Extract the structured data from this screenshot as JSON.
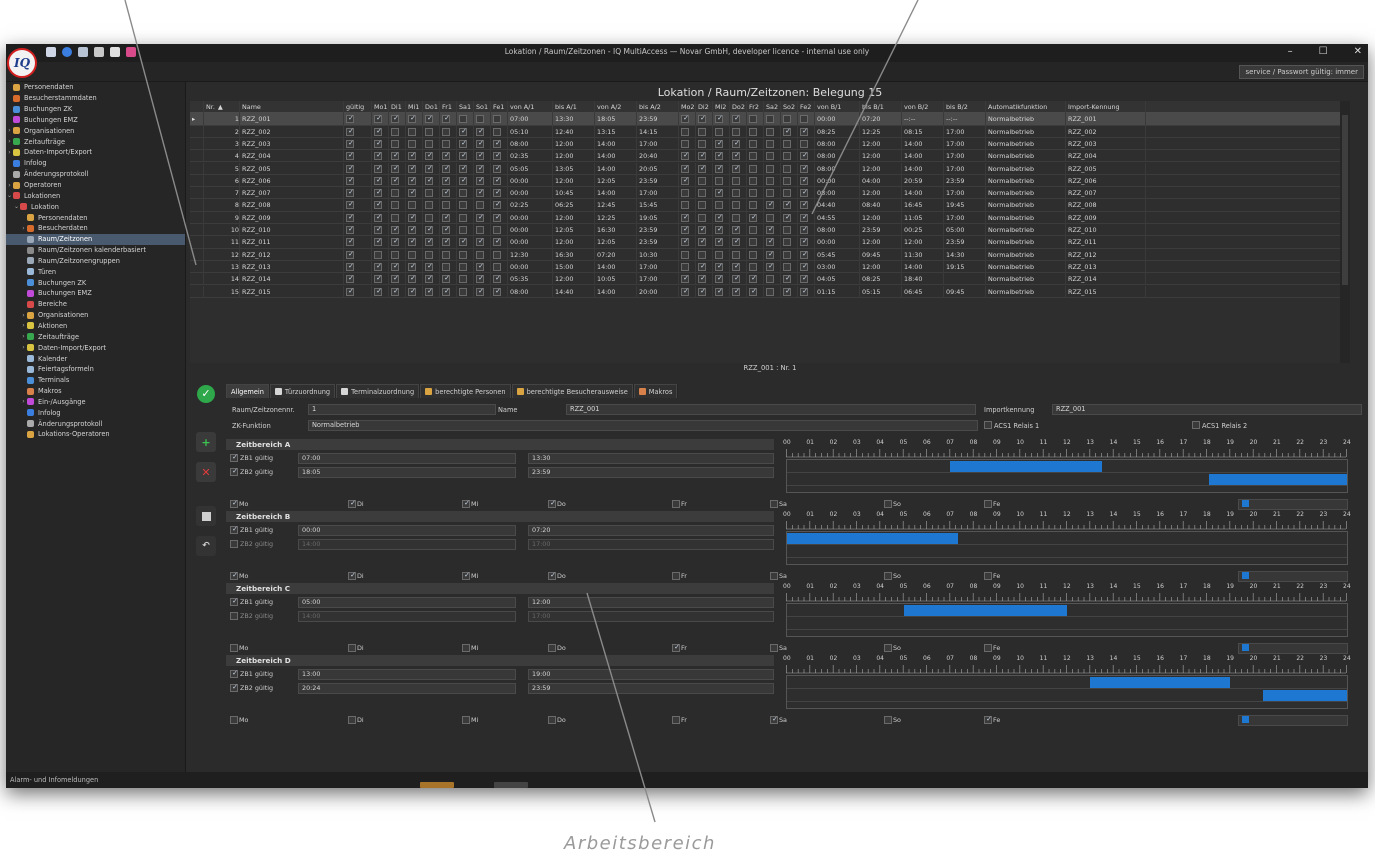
{
  "caption": "Arbeitsbereich",
  "window": {
    "title": "Lokation / Raum/Zeitzonen - IQ MultiAccess — Novar GmbH, developer licence - internal use only",
    "logo_text": "IQ",
    "btn_min": "–",
    "btn_max": "☐",
    "btn_close": "✕",
    "service_button": "service / Passwort gültig: immer",
    "status_text": "Alarm- und Infomeldungen"
  },
  "sidebar": {
    "items": [
      {
        "label": "Personendaten",
        "indent": 0,
        "arrow": "",
        "icon": "#d9a441"
      },
      {
        "label": "Besucherstammdaten",
        "indent": 0,
        "arrow": "",
        "icon": "#d86c2d"
      },
      {
        "label": "Buchungen ZK",
        "indent": 0,
        "arrow": "",
        "icon": "#4a8fd8"
      },
      {
        "label": "Buchungen EMZ",
        "indent": 0,
        "arrow": "",
        "icon": "#c24ad8"
      },
      {
        "label": "Organisationen",
        "indent": 0,
        "arrow": "›",
        "icon": "#d9a441"
      },
      {
        "label": "Zeitaufträge",
        "indent": 0,
        "arrow": "›",
        "icon": "#38a84f"
      },
      {
        "label": "Daten-Import/Export",
        "indent": 0,
        "arrow": "›",
        "icon": "#d9c441"
      },
      {
        "label": "Infolog",
        "indent": 0,
        "arrow": "",
        "icon": "#3a7ee0"
      },
      {
        "label": "Änderungsprotokoll",
        "indent": 0,
        "arrow": "",
        "icon": "#aaaaaa"
      },
      {
        "label": "Operatoren",
        "indent": 0,
        "arrow": "›",
        "icon": "#d9a441"
      },
      {
        "label": "Lokationen",
        "indent": 0,
        "arrow": "⌄",
        "icon": "#d84a4a"
      },
      {
        "label": "Lokation",
        "indent": 1,
        "arrow": "⌄",
        "icon": "#d84a4a"
      },
      {
        "label": "Personendaten",
        "indent": 2,
        "arrow": "",
        "icon": "#d9a441"
      },
      {
        "label": "Besucherdaten",
        "indent": 2,
        "arrow": "›",
        "icon": "#d86c2d"
      },
      {
        "label": "Raum/Zeitzonen",
        "indent": 2,
        "arrow": "",
        "icon": "#9aa8b8",
        "selected": true
      },
      {
        "label": "Raum/Zeitzonen kalenderbasiert",
        "indent": 2,
        "arrow": "",
        "icon": "#8a8a8a"
      },
      {
        "label": "Raum/Zeitzonengruppen",
        "indent": 2,
        "arrow": "",
        "icon": "#9aa8b8"
      },
      {
        "label": "Türen",
        "indent": 2,
        "arrow": "",
        "icon": "#9ab8d8"
      },
      {
        "label": "Buchungen ZK",
        "indent": 2,
        "arrow": "",
        "icon": "#4a8fd8"
      },
      {
        "label": "Buchungen EMZ",
        "indent": 2,
        "arrow": "",
        "icon": "#c24ad8"
      },
      {
        "label": "Bereiche",
        "indent": 2,
        "arrow": "",
        "icon": "#d84a4a"
      },
      {
        "label": "Organisationen",
        "indent": 2,
        "arrow": "›",
        "icon": "#d9a441"
      },
      {
        "label": "Aktionen",
        "indent": 2,
        "arrow": "›",
        "icon": "#d9c441"
      },
      {
        "label": "Zeitaufträge",
        "indent": 2,
        "arrow": "›",
        "icon": "#38a84f"
      },
      {
        "label": "Daten-Import/Export",
        "indent": 2,
        "arrow": "›",
        "icon": "#d9c441"
      },
      {
        "label": "Kalender",
        "indent": 2,
        "arrow": "",
        "icon": "#9ab8d8"
      },
      {
        "label": "Feiertagsformeln",
        "indent": 2,
        "arrow": "",
        "icon": "#9ab8d8"
      },
      {
        "label": "Terminals",
        "indent": 2,
        "arrow": "",
        "icon": "#4a8fd8"
      },
      {
        "label": "Makros",
        "indent": 2,
        "arrow": "",
        "icon": "#d8814a"
      },
      {
        "label": "Ein-/Ausgänge",
        "indent": 2,
        "arrow": "›",
        "icon": "#c24ad8"
      },
      {
        "label": "Infolog",
        "indent": 2,
        "arrow": "",
        "icon": "#3a7ee0"
      },
      {
        "label": "Änderungsprotokoll",
        "indent": 2,
        "arrow": "",
        "icon": "#aaaaaa"
      },
      {
        "label": "Lokations-Operatoren",
        "indent": 2,
        "arrow": "",
        "icon": "#d9a441"
      }
    ]
  },
  "grid": {
    "title": "Lokation / Raum/Zeitzonen: Belegung 15",
    "columns": [
      "Nr.",
      "Name",
      "gültig",
      "Mo1",
      "Di1",
      "Mi1",
      "Do1",
      "Fr1",
      "Sa1",
      "So1",
      "Fe1",
      "von A/1",
      "bis A/1",
      "von A/2",
      "bis A/2",
      "Mo2",
      "Di2",
      "Mi2",
      "Do2",
      "Fr2",
      "Sa2",
      "So2",
      "Fe2",
      "von B/1",
      "bis B/1",
      "von B/2",
      "bis B/2",
      "Automatikfunktion",
      "Import-Kennung"
    ],
    "sort_indicator": "▲",
    "row_marker": "▸",
    "rows": [
      {
        "nr": "1",
        "name": "RZZ_001",
        "checks": "11111000",
        "a1": "07:00",
        "a2": "13:30",
        "a3": "18:05",
        "a4": "23:59",
        "checks2": "11110000",
        "b1": "00:00",
        "b2": "07:20",
        "b3": "--:--",
        "b4": "--:--",
        "auto": "Normalbetrieb",
        "imp": "RZZ_001"
      },
      {
        "nr": "2",
        "name": "RZZ_002",
        "checks": "10000110",
        "a1": "05:10",
        "a2": "12:40",
        "a3": "13:15",
        "a4": "14:15",
        "checks2": "00000011",
        "b1": "08:25",
        "b2": "12:25",
        "b3": "08:15",
        "b4": "17:00",
        "auto": "Normalbetrieb",
        "imp": "RZZ_002"
      },
      {
        "nr": "3",
        "name": "RZZ_003",
        "checks": "10000111",
        "a1": "08:00",
        "a2": "12:00",
        "a3": "14:00",
        "a4": "17:00",
        "checks2": "00110000",
        "b1": "08:00",
        "b2": "12:00",
        "b3": "14:00",
        "b4": "17:00",
        "auto": "Normalbetrieb",
        "imp": "RZZ_003"
      },
      {
        "nr": "4",
        "name": "RZZ_004",
        "checks": "11111111",
        "a1": "02:35",
        "a2": "12:00",
        "a3": "14:00",
        "a4": "20:40",
        "checks2": "11110001",
        "b1": "08:00",
        "b2": "12:00",
        "b3": "14:00",
        "b4": "17:00",
        "auto": "Normalbetrieb",
        "imp": "RZZ_004"
      },
      {
        "nr": "5",
        "name": "RZZ_005",
        "checks": "11111111",
        "a1": "05:05",
        "a2": "13:05",
        "a3": "14:00",
        "a4": "20:05",
        "checks2": "11110001",
        "b1": "08:00",
        "b2": "12:00",
        "b3": "14:00",
        "b4": "17:00",
        "auto": "Normalbetrieb",
        "imp": "RZZ_005"
      },
      {
        "nr": "6",
        "name": "RZZ_006",
        "checks": "11111111",
        "a1": "00:00",
        "a2": "12:00",
        "a3": "12:05",
        "a4": "23:59",
        "checks2": "10000001",
        "b1": "00:00",
        "b2": "04:00",
        "b3": "20:59",
        "b4": "23:59",
        "auto": "Normalbetrieb",
        "imp": "RZZ_006"
      },
      {
        "nr": "7",
        "name": "RZZ_007",
        "checks": "10101011",
        "a1": "00:00",
        "a2": "10:45",
        "a3": "14:00",
        "a4": "17:00",
        "checks2": "00100001",
        "b1": "08:00",
        "b2": "12:00",
        "b3": "14:00",
        "b4": "17:00",
        "auto": "Normalbetrieb",
        "imp": "RZZ_007"
      },
      {
        "nr": "8",
        "name": "RZZ_008",
        "checks": "10000001",
        "a1": "02:25",
        "a2": "06:25",
        "a3": "12:45",
        "a4": "15:45",
        "checks2": "00000111",
        "b1": "04:40",
        "b2": "08:40",
        "b3": "16:45",
        "b4": "19:45",
        "auto": "Normalbetrieb",
        "imp": "RZZ_008"
      },
      {
        "nr": "9",
        "name": "RZZ_009",
        "checks": "10101011",
        "a1": "00:00",
        "a2": "12:00",
        "a3": "12:25",
        "a4": "19:05",
        "checks2": "10101011",
        "b1": "04:55",
        "b2": "12:00",
        "b3": "11:05",
        "b4": "17:00",
        "auto": "Normalbetrieb",
        "imp": "RZZ_009"
      },
      {
        "nr": "10",
        "name": "RZZ_010",
        "checks": "11111000",
        "a1": "00:00",
        "a2": "12:05",
        "a3": "16:30",
        "a4": "23:59",
        "checks2": "11110101",
        "b1": "08:00",
        "b2": "23:59",
        "b3": "00:25",
        "b4": "05:00",
        "auto": "Normalbetrieb",
        "imp": "RZZ_010"
      },
      {
        "nr": "11",
        "name": "RZZ_011",
        "checks": "11111111",
        "a1": "00:00",
        "a2": "12:00",
        "a3": "12:05",
        "a4": "23:59",
        "checks2": "11110101",
        "b1": "00:00",
        "b2": "12:00",
        "b3": "12:00",
        "b4": "23:59",
        "auto": "Normalbetrieb",
        "imp": "RZZ_011"
      },
      {
        "nr": "12",
        "name": "RZZ_012",
        "checks": "00000000",
        "a1": "12:30",
        "a2": "16:30",
        "a3": "07:20",
        "a4": "10:30",
        "checks2": "00000101",
        "b1": "05:45",
        "b2": "09:45",
        "b3": "11:30",
        "b4": "14:30",
        "auto": "Normalbetrieb",
        "imp": "RZZ_012"
      },
      {
        "nr": "13",
        "name": "RZZ_013",
        "checks": "11110010",
        "a1": "00:00",
        "a2": "15:00",
        "a3": "14:00",
        "a4": "17:00",
        "checks2": "01110101",
        "b1": "03:00",
        "b2": "12:00",
        "b3": "14:00",
        "b4": "19:15",
        "auto": "Normalbetrieb",
        "imp": "RZZ_013"
      },
      {
        "nr": "14",
        "name": "RZZ_014",
        "checks": "11111011",
        "a1": "05:35",
        "a2": "12:00",
        "a3": "10:05",
        "a4": "17:00",
        "checks2": "11111011",
        "b1": "04:05",
        "b2": "08:25",
        "b3": "18:40",
        "b4": "",
        "auto": "Normalbetrieb",
        "imp": "RZZ_014"
      },
      {
        "nr": "15",
        "name": "RZZ_015",
        "checks": "11111011",
        "a1": "08:00",
        "a2": "14:40",
        "a3": "14:00",
        "a4": "20:00",
        "checks2": "11111011",
        "b1": "01:15",
        "b2": "05:15",
        "b3": "06:45",
        "b4": "09:45",
        "auto": "Normalbetrieb",
        "imp": "RZZ_015"
      }
    ]
  },
  "record_label": "RZZ_001 : Nr. 1",
  "tabs": [
    {
      "label": "Allgemein",
      "icon": "",
      "active": true
    },
    {
      "label": "Türzuordnung",
      "icon": "#d6d6d6"
    },
    {
      "label": "Terminalzuordnung",
      "icon": "#d6d6d6"
    },
    {
      "label": "berechtigte Personen",
      "icon": "#d9a441"
    },
    {
      "label": "berechtigte Besucherausweise",
      "icon": "#d9a441"
    },
    {
      "label": "Makros",
      "icon": "#d8814a"
    }
  ],
  "form": {
    "nr_label": "Raum/Zeitzonennr.",
    "nr_value": "1",
    "name_label": "Name",
    "name_value": "RZZ_001",
    "import_label": "Importkennung",
    "import_value": "RZZ_001",
    "zk_label": "ZK-Funktion",
    "zk_value": "Normalbetrieb",
    "relay1": "ACS1 Relais 1",
    "relay2": "ACS1 Relais 2"
  },
  "timeline_hours": [
    "00",
    "01",
    "02",
    "03",
    "04",
    "05",
    "06",
    "07",
    "08",
    "09",
    "10",
    "11",
    "12",
    "13",
    "14",
    "15",
    "16",
    "17",
    "18",
    "19",
    "20",
    "21",
    "22",
    "23",
    "24"
  ],
  "zones": [
    {
      "title": "Zeitbereich A",
      "zb1": "ZB1 gültig",
      "zb2": "ZB2 gültig",
      "zb1_on": true,
      "zb2_on": true,
      "zb1_from": "07:00",
      "zb1_to": "13:30",
      "zb2_from": "18:05",
      "zb2_to": "23:59",
      "zb2_dim": false,
      "days": [
        {
          "d": "Mo",
          "on": true
        },
        {
          "d": "Di",
          "on": true
        },
        {
          "d": "Mi",
          "on": true
        },
        {
          "d": "Do",
          "on": true
        },
        {
          "d": "Fr",
          "on": false
        },
        {
          "d": "Sa",
          "on": false
        },
        {
          "d": "So",
          "on": false
        },
        {
          "d": "Fe",
          "on": false
        }
      ],
      "bars": [
        {
          "lane": 0,
          "from": 7.0,
          "to": 13.5
        },
        {
          "lane": 1,
          "from": 18.08,
          "to": 24.0
        }
      ]
    },
    {
      "title": "Zeitbereich B",
      "zb1": "ZB1 gültig",
      "zb2": "ZB2 gültig",
      "zb1_on": true,
      "zb2_on": false,
      "zb1_from": "00:00",
      "zb1_to": "07:20",
      "zb2_from": "14:00",
      "zb2_to": "17:00",
      "zb2_dim": true,
      "days": [
        {
          "d": "Mo",
          "on": true
        },
        {
          "d": "Di",
          "on": true
        },
        {
          "d": "Mi",
          "on": true
        },
        {
          "d": "Do",
          "on": true
        },
        {
          "d": "Fr",
          "on": false
        },
        {
          "d": "Sa",
          "on": false
        },
        {
          "d": "So",
          "on": false
        },
        {
          "d": "Fe",
          "on": false
        }
      ],
      "bars": [
        {
          "lane": 0,
          "from": 0.0,
          "to": 7.33
        }
      ]
    },
    {
      "title": "Zeitbereich C",
      "zb1": "ZB1 gültig",
      "zb2": "ZB2 gültig",
      "zb1_on": true,
      "zb2_on": false,
      "zb1_from": "05:00",
      "zb1_to": "12:00",
      "zb2_from": "14:00",
      "zb2_to": "17:00",
      "zb2_dim": true,
      "days": [
        {
          "d": "Mo",
          "on": false
        },
        {
          "d": "Di",
          "on": false
        },
        {
          "d": "Mi",
          "on": false
        },
        {
          "d": "Do",
          "on": false
        },
        {
          "d": "Fr",
          "on": true
        },
        {
          "d": "Sa",
          "on": false
        },
        {
          "d": "So",
          "on": false
        },
        {
          "d": "Fe",
          "on": false
        }
      ],
      "bars": [
        {
          "lane": 0,
          "from": 5.0,
          "to": 12.0
        }
      ]
    },
    {
      "title": "Zeitbereich D",
      "zb1": "ZB1 gültig",
      "zb2": "ZB2 gültig",
      "zb1_on": true,
      "zb2_on": true,
      "zb1_from": "13:00",
      "zb1_to": "19:00",
      "zb2_from": "20:24",
      "zb2_to": "23:59",
      "zb2_dim": false,
      "days": [
        {
          "d": "Mo",
          "on": false
        },
        {
          "d": "Di",
          "on": false
        },
        {
          "d": "Mi",
          "on": false
        },
        {
          "d": "Do",
          "on": false
        },
        {
          "d": "Fr",
          "on": false
        },
        {
          "d": "Sa",
          "on": true
        },
        {
          "d": "So",
          "on": false
        },
        {
          "d": "Fe",
          "on": true
        }
      ],
      "bars": [
        {
          "lane": 0,
          "from": 13.0,
          "to": 19.0
        },
        {
          "lane": 1,
          "from": 20.4,
          "to": 24.0
        }
      ]
    }
  ]
}
